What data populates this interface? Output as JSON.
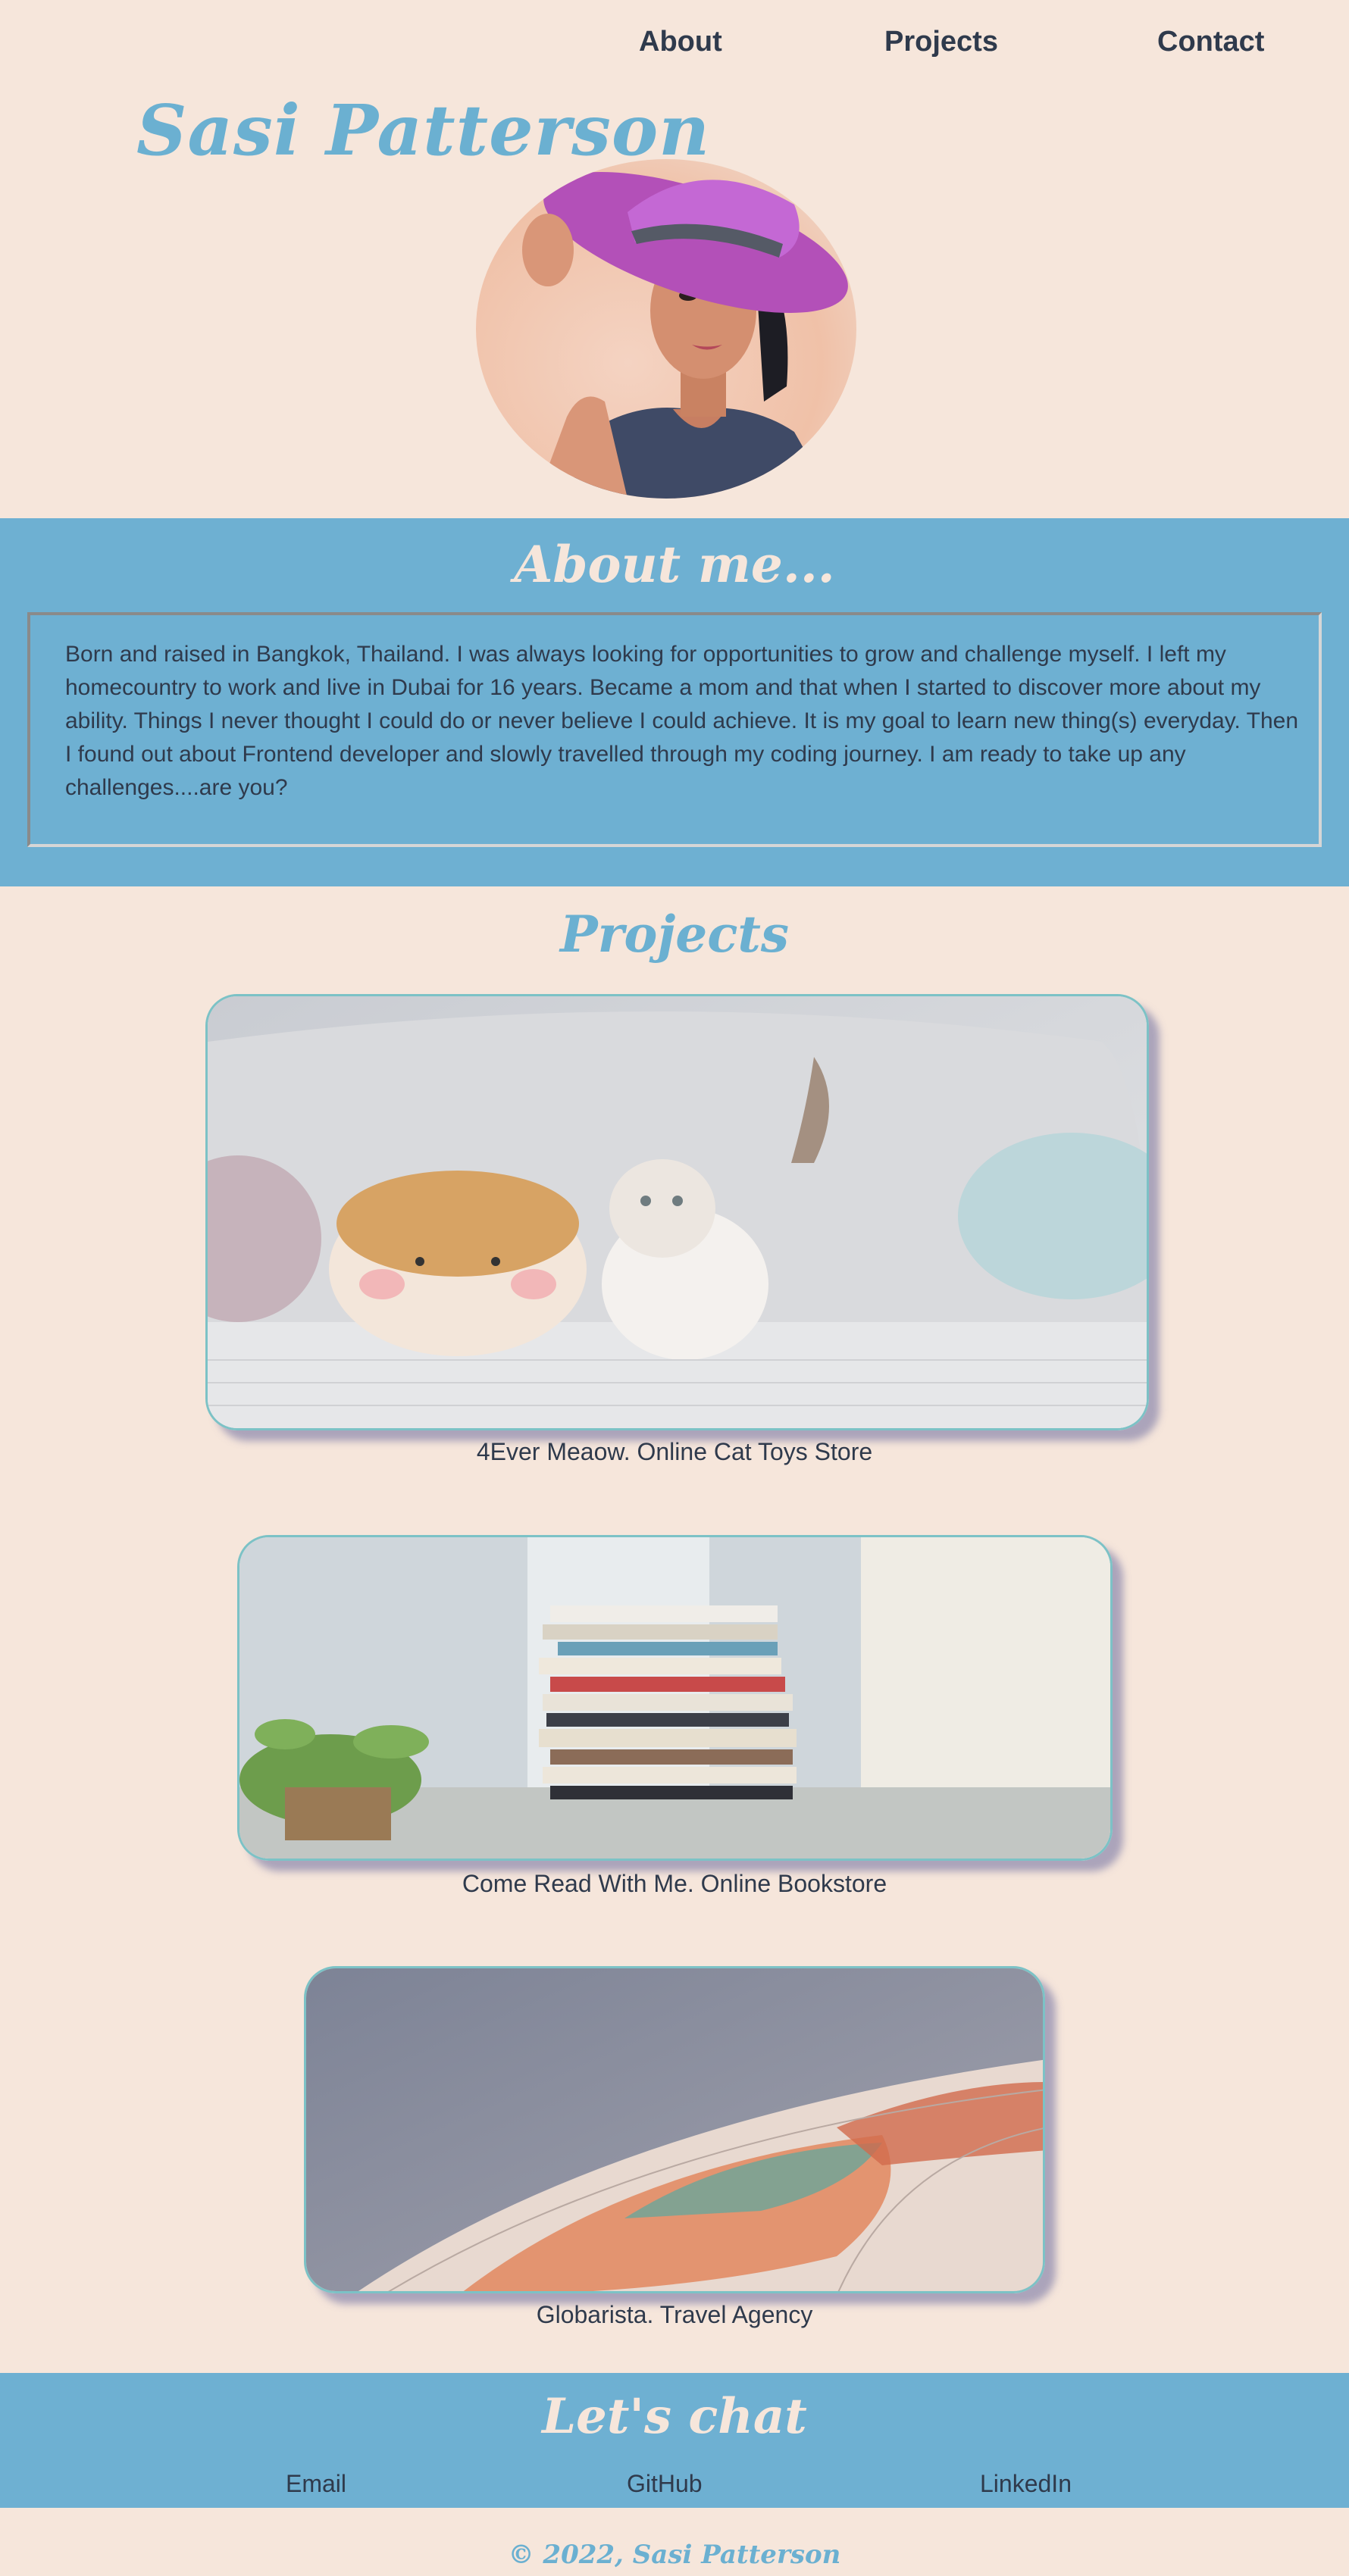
{
  "nav": {
    "items": [
      "About",
      "Projects",
      "Contact"
    ]
  },
  "header": {
    "name": "Sasi Patterson"
  },
  "about": {
    "title": "About me...",
    "text": "Born and raised in Bangkok, Thailand. I was always looking for opportunities to grow and challenge myself. I left my homecountry to work and live in Dubai for 16 years. Became a mom and that when I started to discover more about my ability. Things I never thought I could do or never believe I could achieve. It is my goal to learn new thing(s) everyday. Then I found out about Frontend developer and slowly travelled through my coding journey. I am ready to take up any challenges....are you?"
  },
  "projects": {
    "title": "Projects",
    "items": [
      {
        "caption": "4Ever Meaow. Online Cat Toys Store"
      },
      {
        "caption": "Come Read With Me. Online Bookstore"
      },
      {
        "caption": "Globarista. Travel Agency"
      }
    ]
  },
  "contact": {
    "title": "Let's chat",
    "links": [
      "Email",
      "GitHub",
      "LinkedIn"
    ]
  },
  "footer": {
    "text": "© 2022, Sasi Patterson"
  },
  "colors": {
    "background": "#f6e6db",
    "accent": "#6eb0d2",
    "text": "#2f3a4c"
  }
}
